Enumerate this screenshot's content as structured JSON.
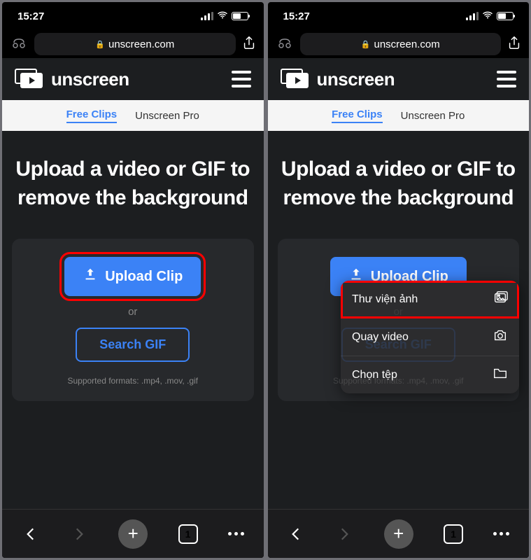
{
  "status": {
    "time": "15:27"
  },
  "url": "unscreen.com",
  "logo_text": "unscreen",
  "tabs": {
    "free": "Free Clips",
    "pro": "Unscreen Pro"
  },
  "hero": "Upload a video or GIF to remove the background",
  "buttons": {
    "upload": "Upload Clip",
    "search": "Search GIF",
    "or": "or"
  },
  "supported": "Supported formats: .mp4, .mov, .gif",
  "bottom": {
    "tabs_count": "1"
  },
  "popup": {
    "items": [
      {
        "label": "Thư viện ảnh"
      },
      {
        "label": "Quay video"
      },
      {
        "label": "Chọn tệp"
      }
    ]
  }
}
